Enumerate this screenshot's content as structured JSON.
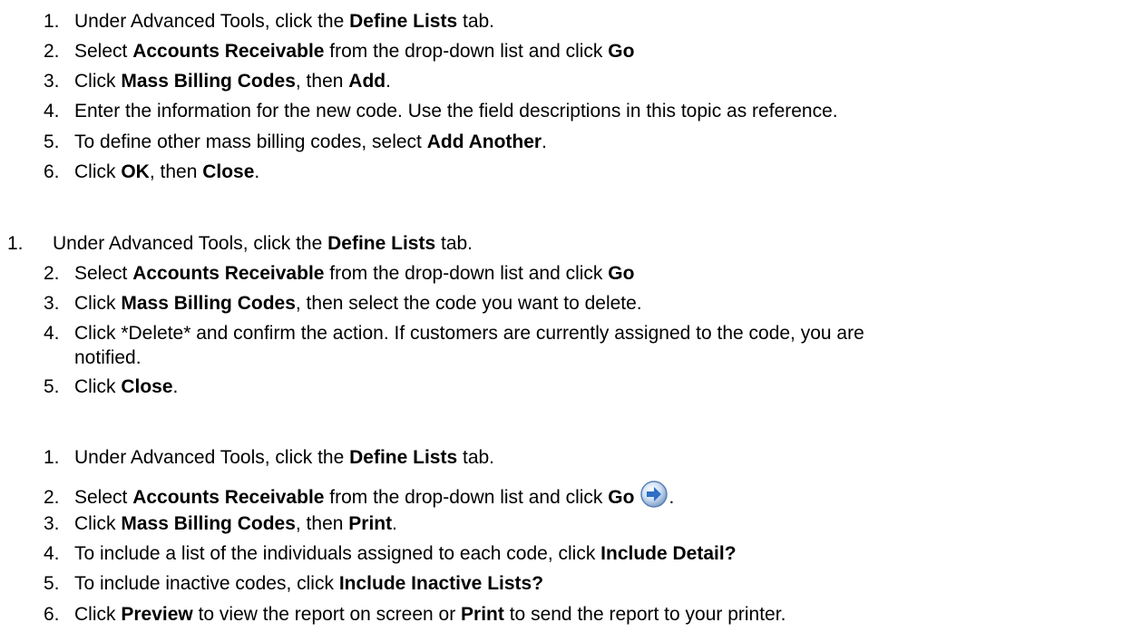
{
  "section_add": {
    "steps": [
      {
        "num": "1.",
        "parts": [
          [
            "Under Advanced Tools, click the ",
            false
          ],
          [
            "Define Lists",
            true
          ],
          [
            " tab.",
            false
          ]
        ]
      },
      {
        "num": "2.",
        "parts": [
          [
            "Select ",
            false
          ],
          [
            "Accounts Receivable",
            true
          ],
          [
            " from the drop-down list and click ",
            false
          ],
          [
            "Go",
            true
          ]
        ]
      },
      {
        "num": "3.",
        "parts": [
          [
            "Click ",
            false
          ],
          [
            "Mass Billing Codes",
            true
          ],
          [
            ", then ",
            false
          ],
          [
            "Add",
            true
          ],
          [
            ".",
            false
          ]
        ]
      },
      {
        "num": "4.",
        "parts": [
          [
            "Enter the information for the new code. Use the field descriptions in this topic as reference.",
            false
          ]
        ]
      },
      {
        "num": "5.",
        "parts": [
          [
            "To define other mass billing codes, select ",
            false
          ],
          [
            "Add Another",
            true
          ],
          [
            ".",
            false
          ]
        ]
      },
      {
        "num": "6.",
        "parts": [
          [
            "Click ",
            false
          ],
          [
            "OK",
            true
          ],
          [
            ", then ",
            false
          ],
          [
            "Close",
            true
          ],
          [
            ".",
            false
          ]
        ]
      }
    ]
  },
  "section_delete": {
    "steps": [
      {
        "num": "1.",
        "parts": [
          [
            "Under Advanced Tools, click the ",
            false
          ],
          [
            "Define Lists",
            true
          ],
          [
            " tab.",
            false
          ]
        ]
      },
      {
        "num": "2.",
        "parts": [
          [
            "Select ",
            false
          ],
          [
            "Accounts Receivable",
            true
          ],
          [
            " from the drop-down list and click ",
            false
          ],
          [
            "Go",
            true
          ]
        ]
      },
      {
        "num": "3.",
        "parts": [
          [
            "Click ",
            false
          ],
          [
            "Mass Billing Codes",
            true
          ],
          [
            ", then select the code you want to delete.",
            false
          ]
        ]
      },
      {
        "num": "4.",
        "parts": [
          [
            "Click *Delete* and confirm the action. If customers are currently assigned to the code, you are",
            false
          ]
        ]
      },
      {
        "num": "",
        "parts": [
          [
            "notified.",
            false
          ]
        ]
      },
      {
        "num": "5.",
        "parts": [
          [
            "Click ",
            false
          ],
          [
            "Close",
            true
          ],
          [
            ".",
            false
          ]
        ]
      }
    ]
  },
  "section_print": {
    "steps": [
      {
        "num": "1.",
        "parts": [
          [
            "Under Advanced Tools, click the ",
            false
          ],
          [
            "Define Lists",
            true
          ],
          [
            " tab.",
            false
          ]
        ]
      },
      {
        "num": "2.",
        "parts": [
          [
            "Select ",
            false
          ],
          [
            "Accounts Receivable",
            true
          ],
          [
            " from the drop-down list and click ",
            false
          ],
          [
            "Go",
            true
          ]
        ],
        "icon": "go-arrow-icon",
        "after_icon": "."
      },
      {
        "num": "3.",
        "parts": [
          [
            "Click ",
            false
          ],
          [
            "Mass Billing Codes",
            true
          ],
          [
            ", then ",
            false
          ],
          [
            "Print",
            true
          ],
          [
            ".",
            false
          ]
        ]
      },
      {
        "num": "4.",
        "parts": [
          [
            "To include a list of the individuals assigned to each code, click ",
            false
          ],
          [
            "Include Detail?",
            true
          ]
        ]
      },
      {
        "num": "5.",
        "parts": [
          [
            "To include inactive codes, click ",
            false
          ],
          [
            "Include Inactive Lists?",
            true
          ]
        ]
      },
      {
        "num": "6.",
        "parts": [
          [
            "Click ",
            false
          ],
          [
            "Preview",
            true
          ],
          [
            " to view the report on screen or ",
            false
          ],
          [
            "Print",
            true
          ],
          [
            " to send the report to your printer.",
            false
          ]
        ]
      }
    ]
  },
  "colors": {
    "text": "#000000",
    "background": "#ffffff",
    "icon_blue": "#2f6fc4"
  }
}
